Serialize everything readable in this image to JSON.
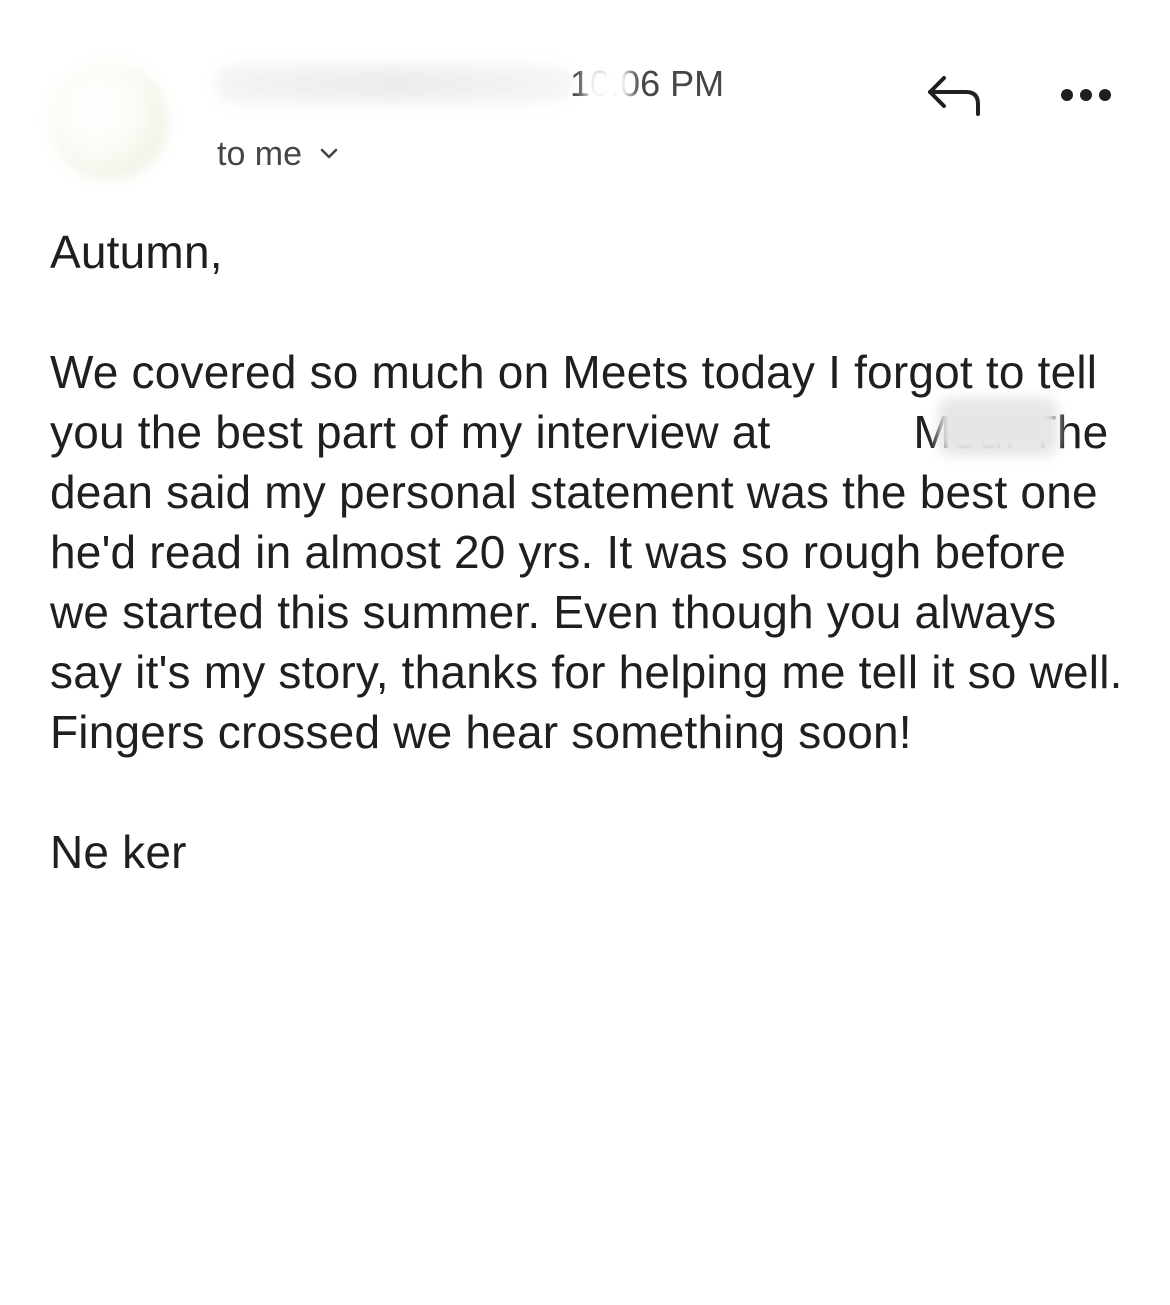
{
  "header": {
    "time": "10:06 PM",
    "recipient_label": "to me",
    "icons": {
      "avatar": "avatar",
      "reply": "reply-icon",
      "more": "more-horizontal-icon",
      "chevron": "chevron-down-icon"
    }
  },
  "message": {
    "greeting": "Autumn,",
    "paragraph": "We covered so much on Meets today I forgot to tell you the best part of my interview at           Med. The dean said my personal statement was the best one he'd read in almost 20 yrs. It was so rough before we started this summer. Even though you always say it's my story, thanks for helping me tell it so well. Fingers crossed we hear something soon!",
    "signature": "Ne          ker"
  }
}
